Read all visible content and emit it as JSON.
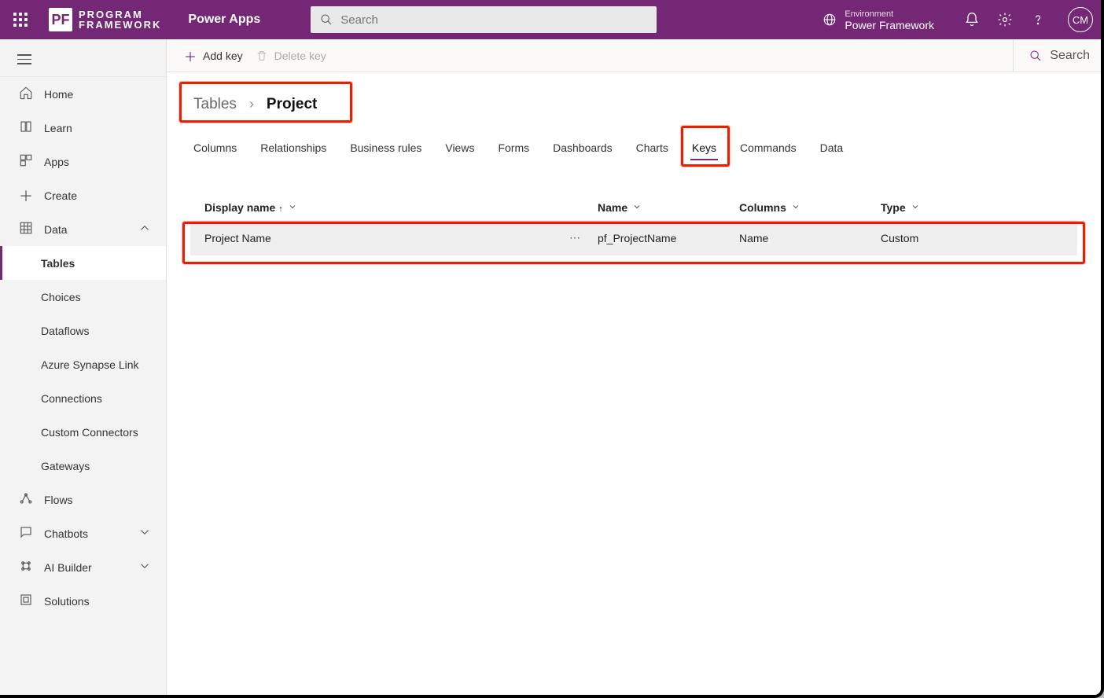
{
  "topbar": {
    "logo_letters": "PF",
    "logo_line1": "PROGRAM",
    "logo_line2": "FRAMEWORK",
    "product": "Power Apps",
    "search_placeholder": "Search",
    "env_label": "Environment",
    "env_name": "Power Framework",
    "avatar": "CM"
  },
  "sidebar": {
    "items": [
      {
        "label": "Home",
        "icon": "home"
      },
      {
        "label": "Learn",
        "icon": "book"
      },
      {
        "label": "Apps",
        "icon": "apps"
      },
      {
        "label": "Create",
        "icon": "plus"
      },
      {
        "label": "Data",
        "icon": "grid",
        "expand": "up"
      },
      {
        "label": "Tables",
        "child": true,
        "active": true
      },
      {
        "label": "Choices",
        "child": true
      },
      {
        "label": "Dataflows",
        "child": true
      },
      {
        "label": "Azure Synapse Link",
        "child": true
      },
      {
        "label": "Connections",
        "child": true
      },
      {
        "label": "Custom Connectors",
        "child": true
      },
      {
        "label": "Gateways",
        "child": true
      },
      {
        "label": "Flows",
        "icon": "flow"
      },
      {
        "label": "Chatbots",
        "icon": "chat",
        "expand": "down"
      },
      {
        "label": "AI Builder",
        "icon": "ai",
        "expand": "down"
      },
      {
        "label": "Solutions",
        "icon": "solution"
      }
    ]
  },
  "cmdbar": {
    "add": "Add key",
    "delete": "Delete key",
    "search": "Search"
  },
  "breadcrumb": {
    "parent": "Tables",
    "current": "Project"
  },
  "tabs": [
    "Columns",
    "Relationships",
    "Business rules",
    "Views",
    "Forms",
    "Dashboards",
    "Charts",
    "Keys",
    "Commands",
    "Data"
  ],
  "active_tab": "Keys",
  "table": {
    "headers": {
      "display_name": "Display name",
      "name": "Name",
      "columns": "Columns",
      "type": "Type"
    },
    "rows": [
      {
        "display_name": "Project Name",
        "name": "pf_ProjectName",
        "columns": "Name",
        "type": "Custom"
      }
    ]
  }
}
